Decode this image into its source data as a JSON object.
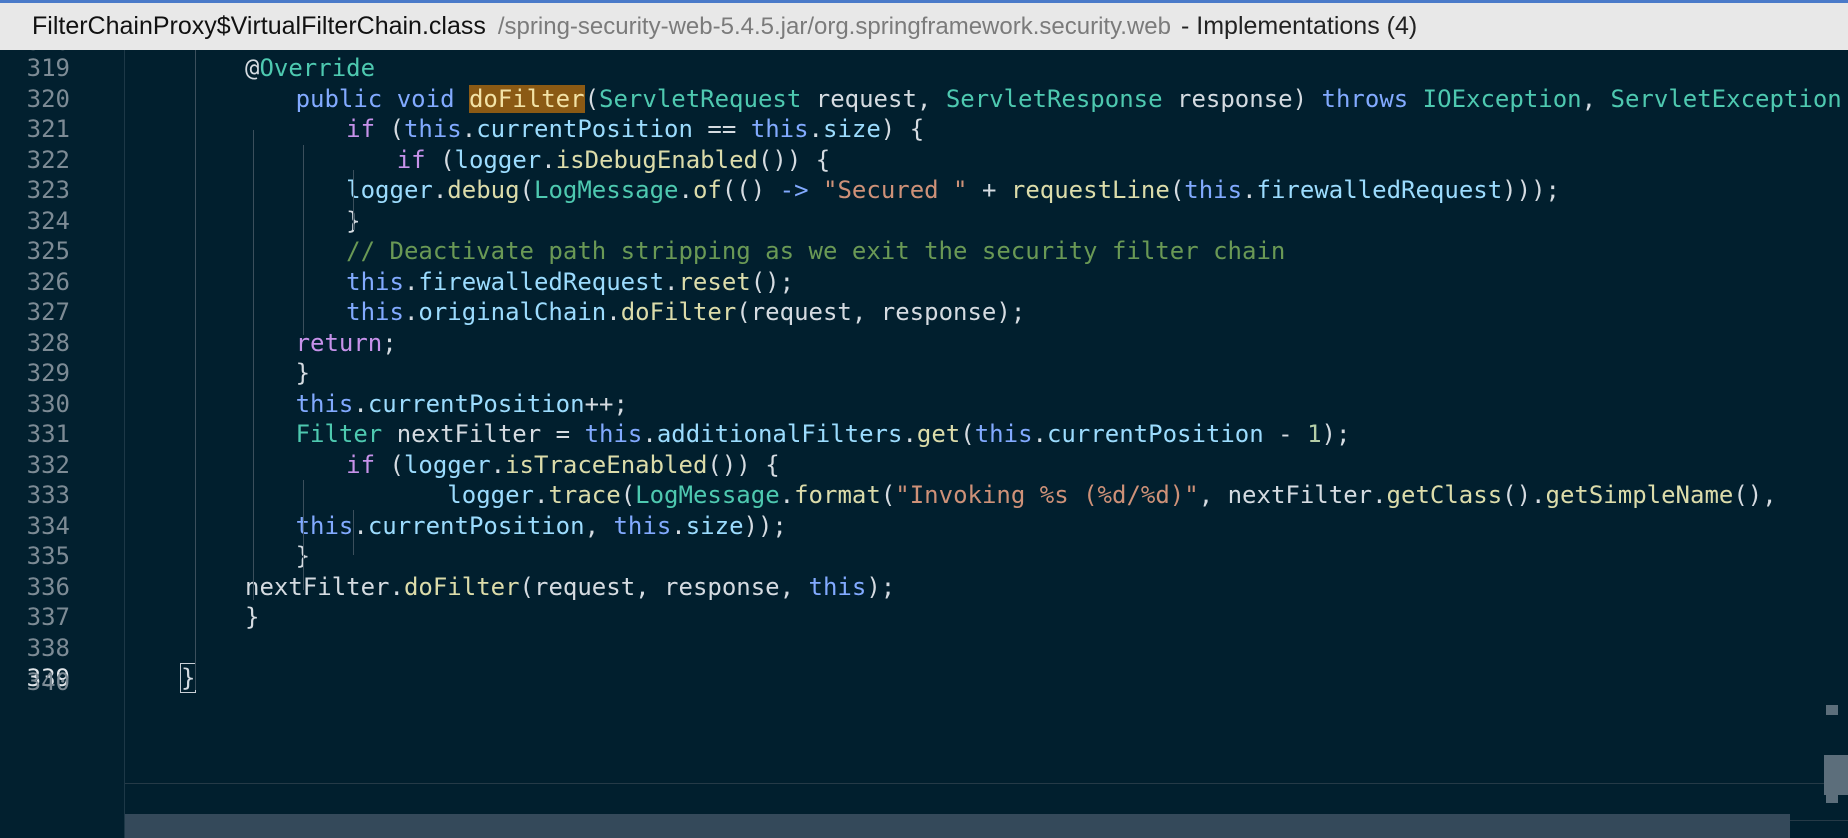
{
  "window": {
    "file_name": "FilterChainProxy$VirtualFilterChain.class",
    "path": "/spring-security-web-5.4.5.jar/org.springframework.security.web",
    "suffix": "- Implementations (4)"
  },
  "editor": {
    "current_line": 339,
    "top_partial_line": "318",
    "bottom_partial_line": "340",
    "lines": [
      {
        "no": "319",
        "tokens": [
          {
            "t": "@",
            "c": "at"
          },
          {
            "t": "Override",
            "c": "ann"
          }
        ]
      },
      {
        "no": "320",
        "tokens": [
          {
            "t": "public",
            "c": "mod"
          },
          {
            "t": " "
          },
          {
            "t": "void",
            "c": "mod"
          },
          {
            "t": " "
          },
          {
            "t": "doFilter",
            "c": "hl"
          },
          {
            "t": "("
          },
          {
            "t": "ServletRequest",
            "c": "ty"
          },
          {
            "t": " request, "
          },
          {
            "t": "ServletResponse",
            "c": "ty"
          },
          {
            "t": " response) "
          },
          {
            "t": "throws",
            "c": "mod"
          },
          {
            "t": " "
          },
          {
            "t": "IOException",
            "c": "ty"
          },
          {
            "t": ", "
          },
          {
            "t": "ServletException",
            "c": "ty"
          },
          {
            "t": " {"
          }
        ]
      },
      {
        "no": "321",
        "tokens": [
          {
            "t": "if",
            "c": "kw"
          },
          {
            "t": " ("
          },
          {
            "t": "this",
            "c": "th"
          },
          {
            "t": "."
          },
          {
            "t": "currentPosition",
            "c": "fld"
          },
          {
            "t": " == "
          },
          {
            "t": "this",
            "c": "th"
          },
          {
            "t": "."
          },
          {
            "t": "size",
            "c": "fld"
          },
          {
            "t": ") {"
          }
        ]
      },
      {
        "no": "322",
        "tokens": [
          {
            "t": "if",
            "c": "kw"
          },
          {
            "t": " ("
          },
          {
            "t": "logger",
            "c": "fld"
          },
          {
            "t": "."
          },
          {
            "t": "isDebugEnabled",
            "c": "fn"
          },
          {
            "t": "()) {"
          }
        ]
      },
      {
        "no": "323",
        "tokens": [
          {
            "t": "logger",
            "c": "fld"
          },
          {
            "t": "."
          },
          {
            "t": "debug",
            "c": "fn"
          },
          {
            "t": "("
          },
          {
            "t": "LogMessage",
            "c": "ty"
          },
          {
            "t": "."
          },
          {
            "t": "of",
            "c": "fn"
          },
          {
            "t": "(() "
          },
          {
            "t": "->",
            "c": "op"
          },
          {
            "t": " "
          },
          {
            "t": "\"Secured \"",
            "c": "str"
          },
          {
            "t": " + "
          },
          {
            "t": "requestLine",
            "c": "fn"
          },
          {
            "t": "("
          },
          {
            "t": "this",
            "c": "th"
          },
          {
            "t": "."
          },
          {
            "t": "firewalledRequest",
            "c": "fld"
          },
          {
            "t": ")));"
          }
        ]
      },
      {
        "no": "324",
        "tokens": [
          {
            "t": "}"
          }
        ]
      },
      {
        "no": "325",
        "tokens": [
          {
            "t": "// Deactivate path stripping as we exit the security filter chain",
            "c": "cmt"
          }
        ]
      },
      {
        "no": "326",
        "tokens": [
          {
            "t": "this",
            "c": "th"
          },
          {
            "t": "."
          },
          {
            "t": "firewalledRequest",
            "c": "fld"
          },
          {
            "t": "."
          },
          {
            "t": "reset",
            "c": "fn"
          },
          {
            "t": "();"
          }
        ]
      },
      {
        "no": "327",
        "tokens": [
          {
            "t": "this",
            "c": "th"
          },
          {
            "t": "."
          },
          {
            "t": "originalChain",
            "c": "fld"
          },
          {
            "t": "."
          },
          {
            "t": "doFilter",
            "c": "fn"
          },
          {
            "t": "(request, response);"
          }
        ]
      },
      {
        "no": "328",
        "tokens": [
          {
            "t": "return",
            "c": "kw"
          },
          {
            "t": ";"
          }
        ]
      },
      {
        "no": "329",
        "tokens": [
          {
            "t": "}"
          }
        ]
      },
      {
        "no": "330",
        "tokens": [
          {
            "t": "this",
            "c": "th"
          },
          {
            "t": "."
          },
          {
            "t": "currentPosition",
            "c": "fld"
          },
          {
            "t": "++;"
          }
        ]
      },
      {
        "no": "331",
        "tokens": [
          {
            "t": "Filter",
            "c": "ty"
          },
          {
            "t": " nextFilter = "
          },
          {
            "t": "this",
            "c": "th"
          },
          {
            "t": "."
          },
          {
            "t": "additionalFilters",
            "c": "fld"
          },
          {
            "t": "."
          },
          {
            "t": "get",
            "c": "fn"
          },
          {
            "t": "("
          },
          {
            "t": "this",
            "c": "th"
          },
          {
            "t": "."
          },
          {
            "t": "currentPosition",
            "c": "fld"
          },
          {
            "t": " - "
          },
          {
            "t": "1",
            "c": "num"
          },
          {
            "t": ");"
          }
        ]
      },
      {
        "no": "332",
        "tokens": [
          {
            "t": "if",
            "c": "kw"
          },
          {
            "t": " ("
          },
          {
            "t": "logger",
            "c": "fld"
          },
          {
            "t": "."
          },
          {
            "t": "isTraceEnabled",
            "c": "fn"
          },
          {
            "t": "()) {"
          }
        ]
      },
      {
        "no": "333",
        "tokens": [
          {
            "t": "logger",
            "c": "fld"
          },
          {
            "t": "."
          },
          {
            "t": "trace",
            "c": "fn"
          },
          {
            "t": "("
          },
          {
            "t": "LogMessage",
            "c": "ty"
          },
          {
            "t": "."
          },
          {
            "t": "format",
            "c": "fn"
          },
          {
            "t": "("
          },
          {
            "t": "\"Invoking %s (%d/%d)\"",
            "c": "str"
          },
          {
            "t": ", nextFilter."
          },
          {
            "t": "getClass",
            "c": "fn"
          },
          {
            "t": "()."
          },
          {
            "t": "getSimpleName",
            "c": "fn"
          },
          {
            "t": "(),"
          }
        ]
      },
      {
        "no": "334",
        "tokens": [
          {
            "t": "this",
            "c": "th"
          },
          {
            "t": "."
          },
          {
            "t": "currentPosition",
            "c": "fld"
          },
          {
            "t": ", "
          },
          {
            "t": "this",
            "c": "th"
          },
          {
            "t": "."
          },
          {
            "t": "size",
            "c": "fld"
          },
          {
            "t": "));"
          }
        ]
      },
      {
        "no": "335",
        "tokens": [
          {
            "t": "}"
          }
        ]
      },
      {
        "no": "336",
        "tokens": [
          {
            "t": "nextFilter."
          },
          {
            "t": "doFilter",
            "c": "fn"
          },
          {
            "t": "(request, response, "
          },
          {
            "t": "this",
            "c": "th"
          },
          {
            "t": ");"
          }
        ]
      },
      {
        "no": "337",
        "tokens": [
          {
            "t": "}"
          }
        ]
      },
      {
        "no": "338",
        "tokens": []
      },
      {
        "no": "339",
        "tokens": [
          {
            "t": "}",
            "c": "cur-brace"
          }
        ]
      }
    ]
  }
}
